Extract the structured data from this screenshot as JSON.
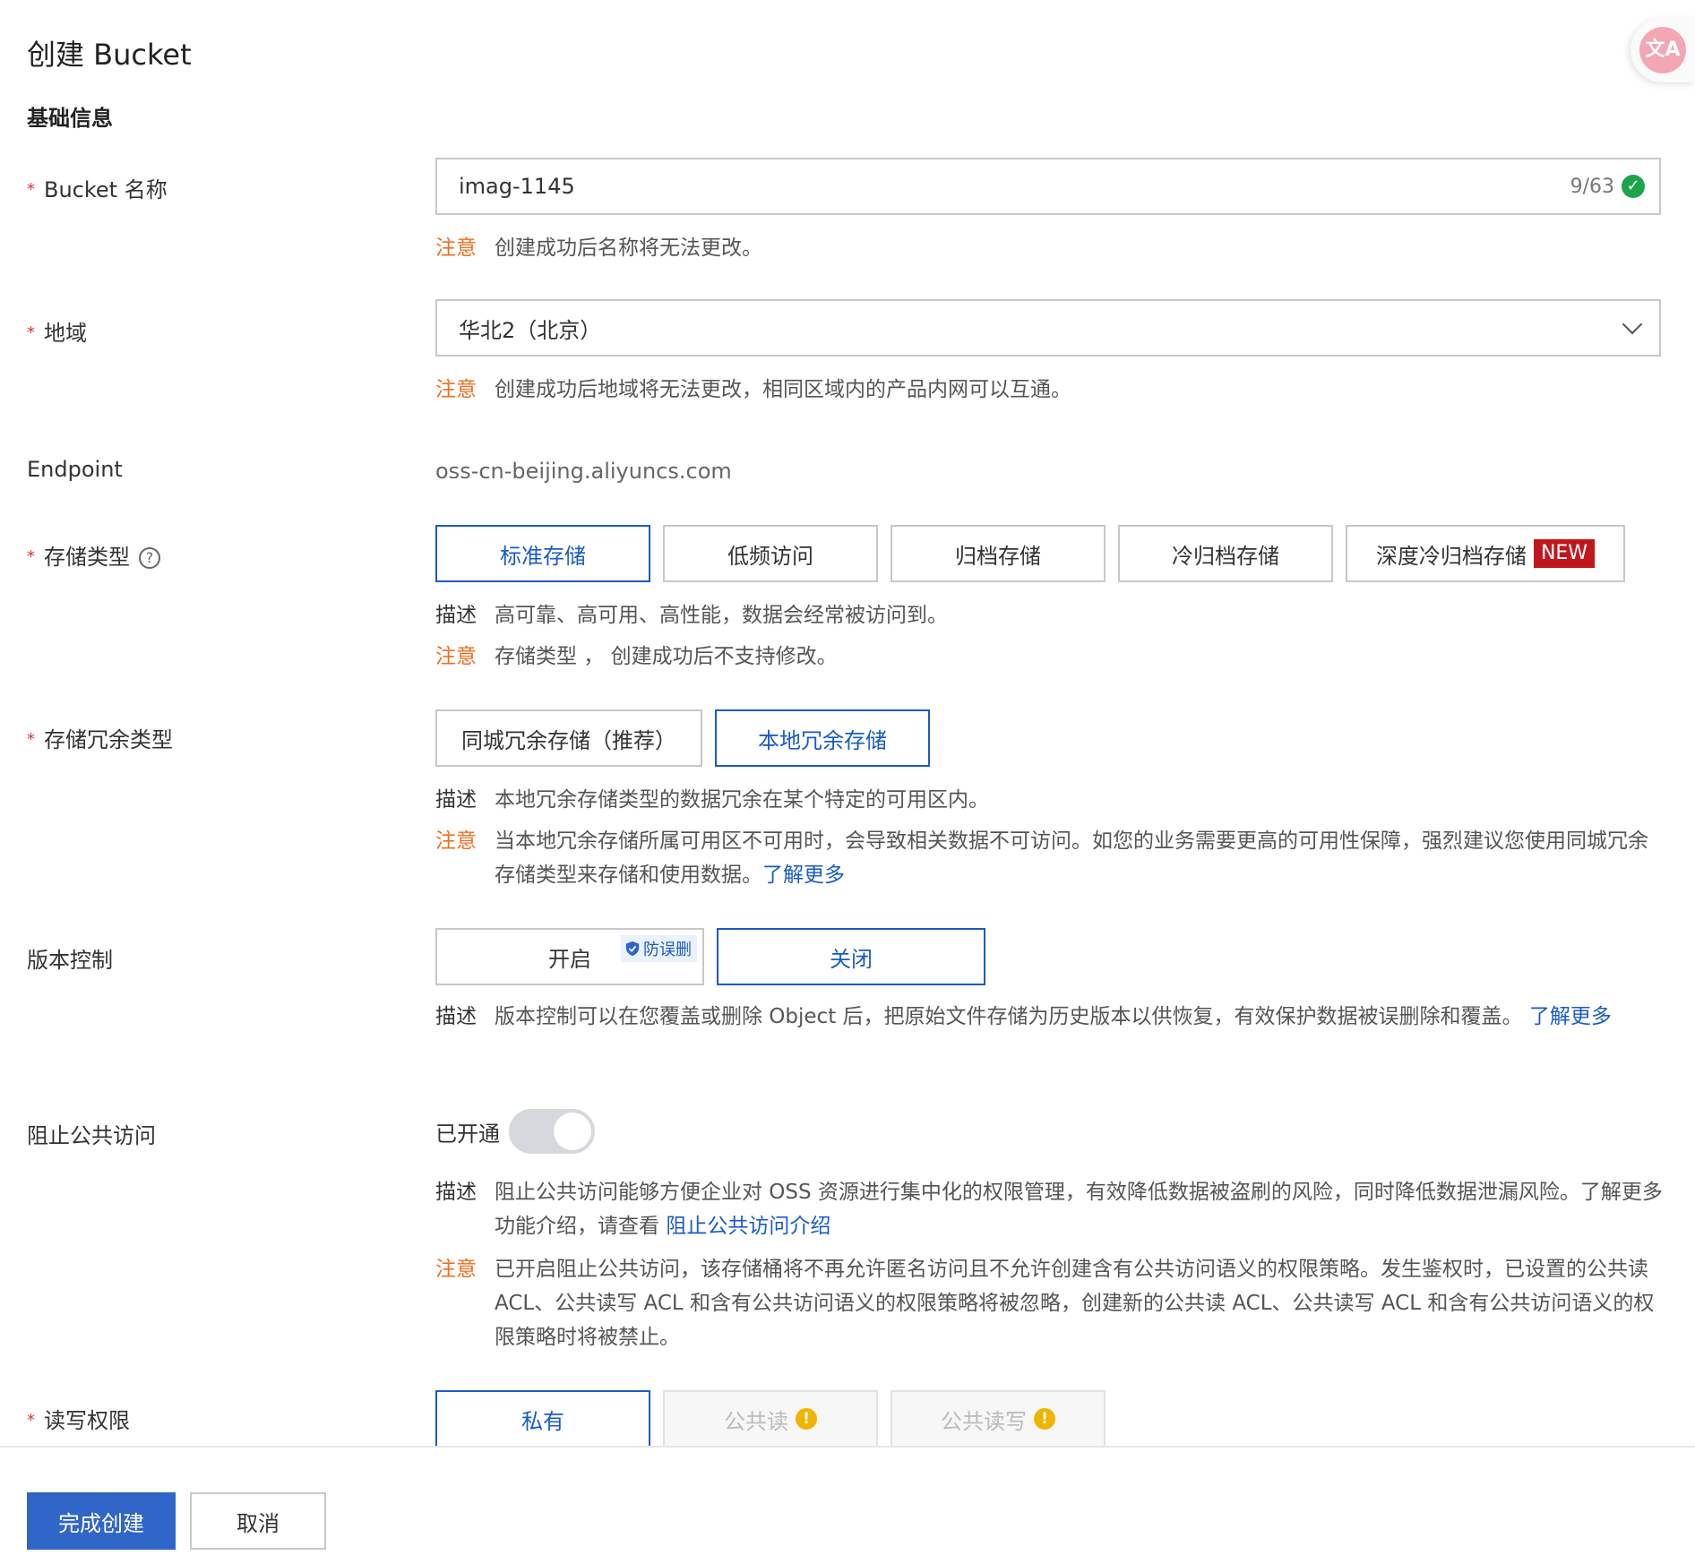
{
  "page": {
    "title": "创建 Bucket",
    "section": "基础信息"
  },
  "bucket_name": {
    "label": "Bucket 名称",
    "value": "imag-1145",
    "count": "9/63",
    "note_tag": "注意",
    "note": "创建成功后名称将无法更改。"
  },
  "region": {
    "label": "地域",
    "value": "华北2（北京）",
    "note_tag": "注意",
    "note": "创建成功后地域将无法更改，相同区域内的产品内网可以互通。"
  },
  "endpoint": {
    "label": "Endpoint",
    "value": "oss-cn-beijing.aliyuncs.com"
  },
  "storage_class": {
    "label": "存储类型",
    "options": [
      "标准存储",
      "低频访问",
      "归档存储",
      "冷归档存储",
      "深度冷归档存储"
    ],
    "new_badge": "NEW",
    "desc_tag": "描述",
    "desc": "高可靠、高可用、高性能，数据会经常被访问到。",
    "note_tag": "注意",
    "note": "存储类型 ， 创建成功后不支持修改。"
  },
  "redundancy": {
    "label": "存储冗余类型",
    "options": [
      "同城冗余存储（推荐）",
      "本地冗余存储"
    ],
    "desc_tag": "描述",
    "desc": "本地冗余存储类型的数据冗余在某个特定的可用区内。",
    "note_tag": "注意",
    "note": "当本地冗余存储所属可用区不可用时，会导致相关数据不可访问。如您的业务需要更高的可用性保障，强烈建议您使用同城冗余存储类型来存储和使用数据。",
    "link": "了解更多"
  },
  "versioning": {
    "label": "版本控制",
    "options": [
      "开启",
      "关闭"
    ],
    "protect_badge": "防误删",
    "desc_tag": "描述",
    "desc": "版本控制可以在您覆盖或删除 Object 后，把原始文件存储为历史版本以供恢复，有效保护数据被误删除和覆盖。",
    "link": "了解更多"
  },
  "block_public": {
    "label": "阻止公共访问",
    "switch_label": "已开通",
    "switch_on": true,
    "desc_tag": "描述",
    "desc": "阻止公共访问能够方便企业对 OSS 资源进行集中化的权限管理，有效降低数据被盗刷的风险，同时降低数据泄漏风险。了解更多功能介绍，请查看",
    "link": "阻止公共访问介绍",
    "note_tag": "注意",
    "note": "已开启阻止公共访问，该存储桶将不再允许匿名访问且不允许创建含有公共访问语义的权限策略。发生鉴权时，已设置的公共读 ACL、公共读写 ACL 和含有公共访问语义的权限策略将被忽略，创建新的公共读 ACL、公共读写 ACL 和含有公共访问语义的权限策略时将被禁止。"
  },
  "acl": {
    "label": "读写权限",
    "options": [
      "私有",
      "公共读",
      "公共读写"
    ]
  },
  "footer": {
    "submit": "完成创建",
    "cancel": "取消"
  },
  "colors": {
    "primary": "#2f66c8",
    "link": "#1a5cc4",
    "warning": "#f06e1f",
    "required": "#d9363e",
    "new_badge": "#c0171d"
  }
}
